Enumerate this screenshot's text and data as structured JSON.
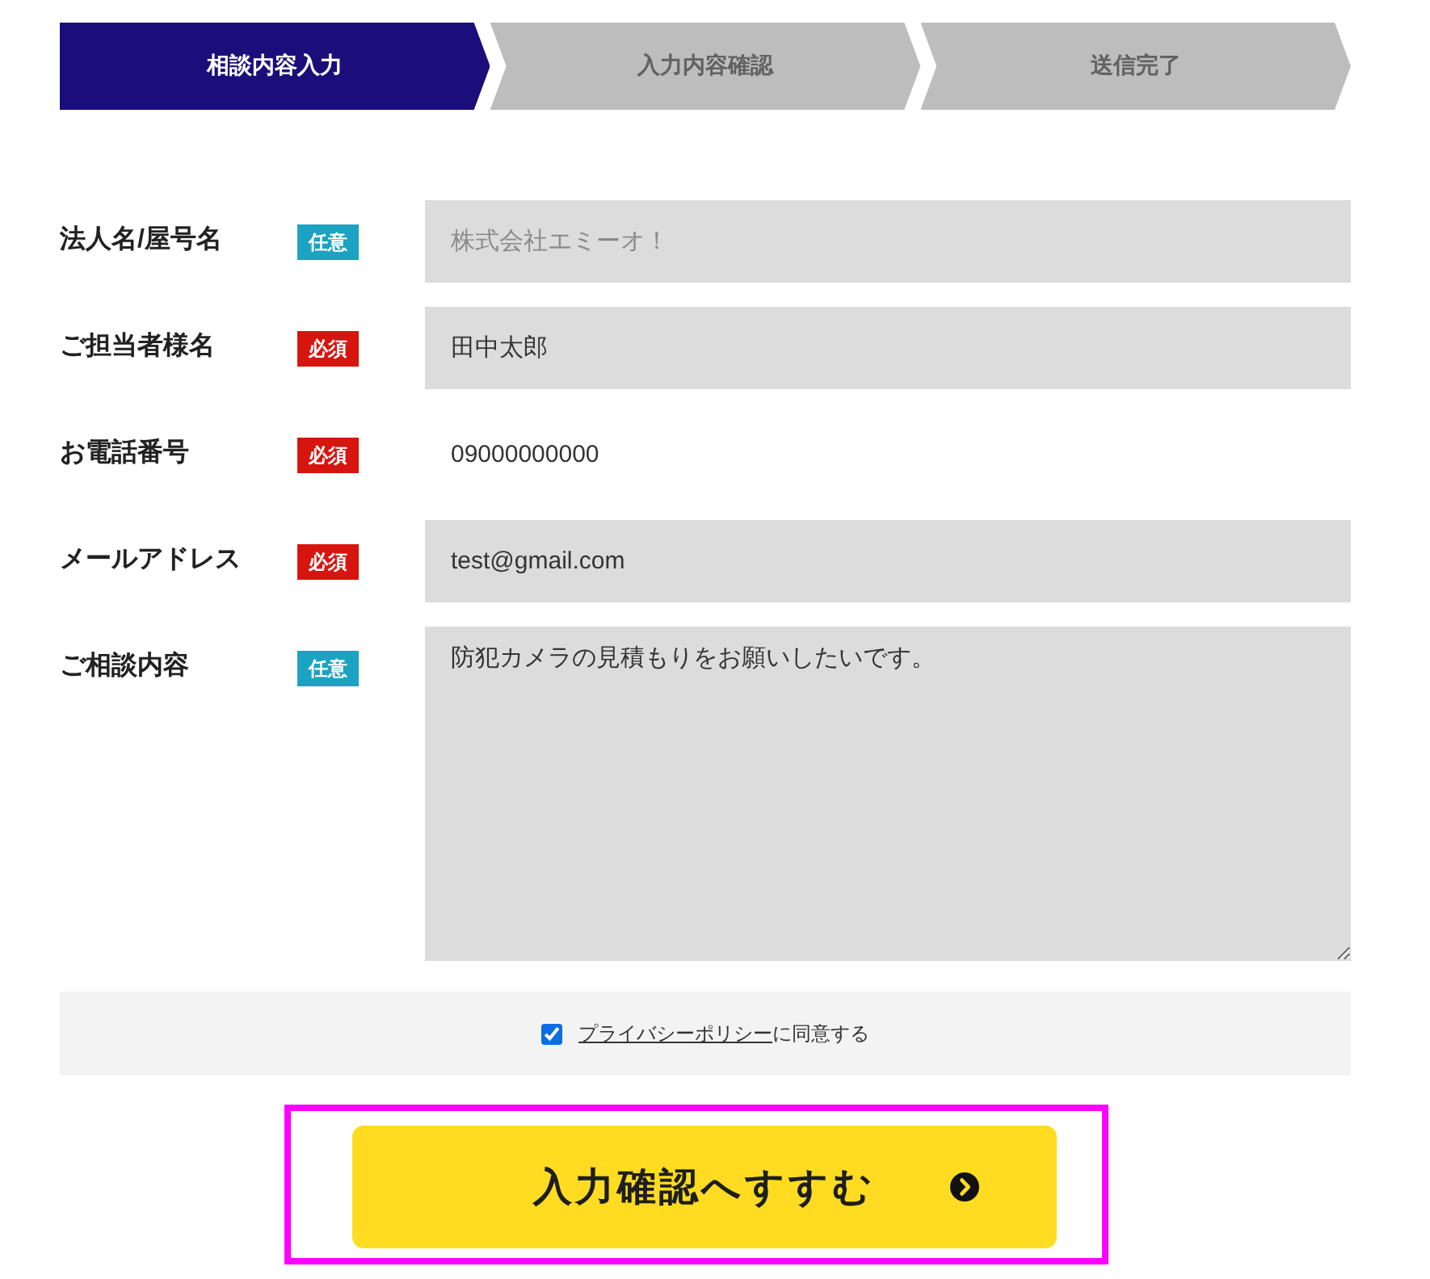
{
  "steps": [
    {
      "label": "相談内容入力",
      "selected": true
    },
    {
      "label": "入力内容確認",
      "selected": false
    },
    {
      "label": "送信完了",
      "selected": false
    }
  ],
  "form": {
    "fields": [
      {
        "label": "法人名/屋号名",
        "badge": "任意",
        "required": false,
        "kind": "text",
        "placeholder": "株式会社エミーオ！"
      },
      {
        "label": "ご担当者様名",
        "badge": "必須",
        "required": true,
        "kind": "text",
        "value": "田中太郎"
      },
      {
        "label": "お電話番号",
        "badge": "必須",
        "required": true,
        "kind": "plain",
        "value": "09000000000"
      },
      {
        "label": "メールアドレス",
        "badge": "必須",
        "required": true,
        "kind": "text",
        "value": "test@gmail.com"
      },
      {
        "label": "ご相談内容",
        "badge": "任意",
        "required": false,
        "kind": "textarea",
        "value": "防犯カメラの見積もりをお願いしたいです。"
      }
    ]
  },
  "agreement": {
    "checked": true,
    "link_text": "プライバシーポリシー",
    "text": "に同意する"
  },
  "submit": {
    "label": "入力確認へすすむ",
    "highlighted": true
  }
}
